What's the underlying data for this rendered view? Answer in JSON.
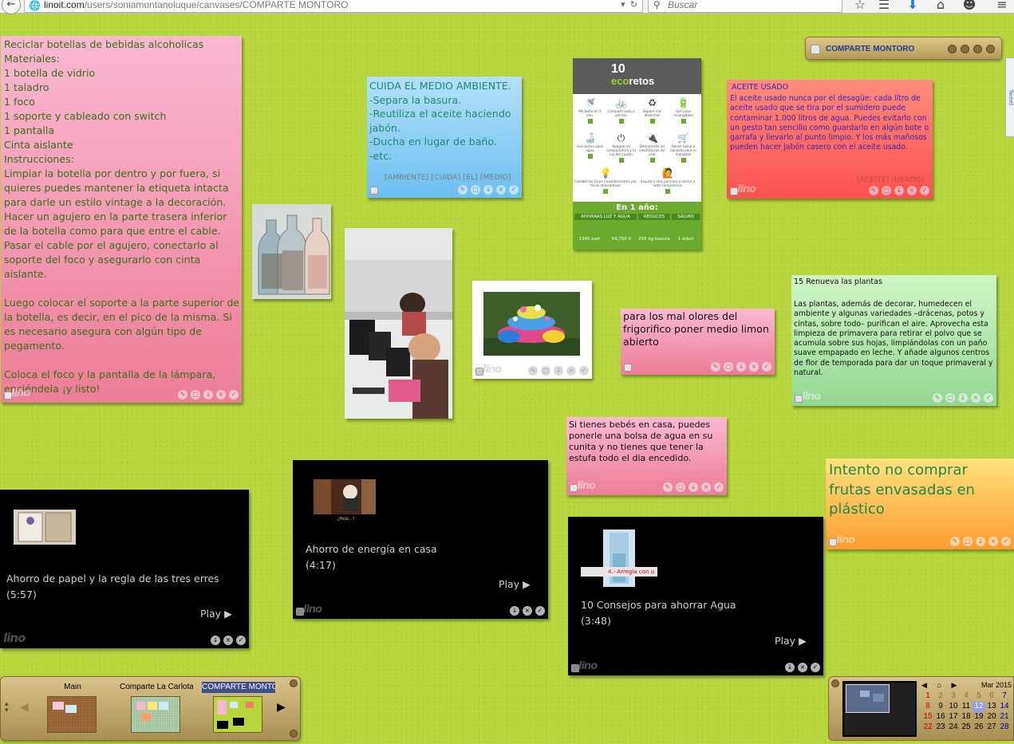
{
  "browser": {
    "url_domain": "linoit.com",
    "url_path": "/users/soniamontanoluque/canvases/COMPARTE MONTORO",
    "search_placeholder": "Buscar",
    "icons": [
      "back-arrow-icon",
      "globe-icon",
      "reload-icon",
      "search-icon",
      "star-icon",
      "bookmarks-list-icon",
      "download-icon",
      "home-icon",
      "chat-icon",
      "menu-icon"
    ]
  },
  "canvas_box": {
    "name": "COMPARTE MONTORO"
  },
  "sidetab": {
    "label": "Tweet"
  },
  "notes": {
    "reciclar": {
      "text": "Reciclar botellas de bebidas alcoholicas\nMateriales:\n1 botella de vidrio\n1 taladro\n1 foco\n1 soporte y cableado con switch\n1 pantalla\nCinta aislante\nInstrucciones:\nLimpiar la botella por dentro y por fuera, si quieres puedes mantener la etiqueta intacta para darle un estilo vintage a la decoración.\nHacer un agujero en la parte trasera inferior de la botella como para que entre el cable.\nPasar el cable por el agujero, conectarlo al soporte del foco y asegurarlo con cinta aislante.\n\nLuego colocar el soporte a la parte superior de la botella, es decir, en el pico de la misma. Si es necesario asegura con algún tipo de pegamento.\n\nColoca el foco y la pantalla de la lámpara, enciéndela ¡y listo!"
    },
    "cuida": {
      "text": "CUIDA EL MEDIO AMBIENTE.\n-Separa la basura.\n-Reutiliza el aceite haciendo jabón.\n-Ducha en lugar de baño.\n-etc.",
      "tags": "[AMBIENTE] [CUIDA] [EL] [MEDIO]"
    },
    "aceite": {
      "title": "ACEITE USADO",
      "text": "El aceite usado nunca por el desagüe: cada litro de aceite usado que se tira por el sumidero puede contaminar 1.000 litros de agua. Puedes evitarlo con un gesto tan sencillo como guardarlo en algún bote o garrafa y llevarlo al punto limpio. Y los más mañosos pueden hacer jabón casero con el aceite usado.",
      "tags": "[ACEITE] [USADO]"
    },
    "limon": {
      "text": "para los mal olores del frigorifico poner medio limon abierto"
    },
    "plantas": {
      "title": "15 Renueva las plantas",
      "text": "Las plantas, además de decorar, humedecen el ambiente y algunas variedades –drácenas, potos y cintas, sobre todo– purifican el aire. Aprovecha esta limpieza de primavera para retirar el polvo que se acumula sobre sus hojas, limpiándolas con un paño suave empapado en leche. Y añade algunos centros de flor de temporada para dar un toque primaveral y natural."
    },
    "bebes": {
      "text": "Si tienes bebés en casa, puedes ponerle una bolsa de agua en su cunita y no tienes que tener la estufa todo el dia encedido."
    },
    "frutas": {
      "text": "Intento no comprar frutas envasadas en plástico"
    }
  },
  "ecoretos": {
    "title_num": "10",
    "title_a": "eco",
    "title_b": "retos",
    "items": [
      "Me baño en 5 min.",
      "Comparti auto o usé bici",
      "Separé mis desechos",
      "Usé pilas recargables",
      "Usé termo para agua",
      "Apagué mi computadora y la luz del cuarto",
      "Desconecté los electrónicos sin usar",
      "Reusé bolsa o canasta para el mandado",
      "Cambié los focos incandescentes por focos ahorradores",
      "Inspiré a otra persona a unirse a este compromiso"
    ],
    "year_label": "En 1 año:",
    "stats_headers": [
      "AHORRAS LUZ Y AGUA",
      "REDUCES",
      "SALVAS"
    ],
    "stats_values": [
      "1345 kwh",
      "54,750 lt",
      "255 kg basura",
      "1 árbol"
    ]
  },
  "videos": {
    "papel": {
      "title": "Ahorro de papel y la regla de las tres erres\n(5:57)",
      "play": "Play"
    },
    "energia": {
      "title": "Ahorro de energía en casa\n(4:17)",
      "play": "Play",
      "caption": "¿Hola...?"
    },
    "agua": {
      "title": "10 Consejos para ahorrar Agua\n(3:48)",
      "play": "Play",
      "caption": "4.- Arregla con u"
    }
  },
  "tabs": [
    {
      "label": "Main"
    },
    {
      "label": "Comparte La Carlota"
    },
    {
      "label": "COMPARTE MONTORO"
    }
  ],
  "calendar": {
    "month": "Mar 2015",
    "weeks": [
      [
        "1",
        "2",
        "3",
        "4",
        "5",
        "6",
        "7"
      ],
      [
        "8",
        "9",
        "10",
        "11",
        "12",
        "13",
        "14"
      ],
      [
        "15",
        "16",
        "17",
        "18",
        "19",
        "20",
        "21"
      ],
      [
        "22",
        "23",
        "24",
        "25",
        "26",
        "27",
        "28"
      ]
    ],
    "today": "12"
  },
  "colors": {
    "background": "#b6d63c",
    "tab_active": "#3d4e8a",
    "canvas_name": "#1f3f8a"
  }
}
